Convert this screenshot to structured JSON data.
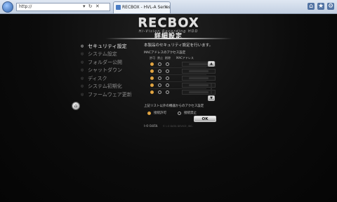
{
  "browser": {
    "address": "http://",
    "tab_title": "RECBOX - HVL-A Series",
    "tab_close": "×",
    "address_controls": "▾ ↻ ✕",
    "icons": [
      "back-icon",
      "forward-icon",
      "home-icon",
      "star-icon",
      "gear-icon"
    ]
  },
  "header": {
    "logo": "RECBOX",
    "tagline": "Hi-Vision Recording HDD",
    "page_title": "詳細設定"
  },
  "menu": {
    "items": [
      {
        "label": "セキュリティ設定",
        "active": true
      },
      {
        "label": "システム設定",
        "active": false
      },
      {
        "label": "フォルダー公開",
        "active": false
      },
      {
        "label": "シャットダウン",
        "active": false
      },
      {
        "label": "ディスク",
        "active": false
      },
      {
        "label": "システム初期化",
        "active": false
      },
      {
        "label": "ファームウェア更新",
        "active": false
      }
    ]
  },
  "content": {
    "description": "本製品のセキュリティ設定を行います。",
    "mac_section_label": "MACアドレスのアクセス設定",
    "columns": {
      "allow": "許可",
      "deny": "禁止",
      "delete": "削除",
      "mac": "MACアドレス"
    },
    "mac_rows": [
      {
        "state": "allow"
      },
      {
        "state": "allow"
      },
      {
        "state": "allow"
      },
      {
        "state": "allow"
      },
      {
        "state": "allow"
      }
    ],
    "access_section_label": "上記リスト以外の機器からのアクセス設定",
    "access_options": [
      {
        "label": "接続許可",
        "selected": true
      },
      {
        "label": "接続禁止",
        "selected": false
      }
    ],
    "ok_label": "OK"
  },
  "footer": {
    "logo": "I-O DATA",
    "text": "© I-O DATA DEVICE, INC."
  },
  "colors": {
    "accent": "#e2a640",
    "background": "#0c0c0c",
    "text_active": "#f0f0f0",
    "text_inactive": "#8a8a8a"
  }
}
